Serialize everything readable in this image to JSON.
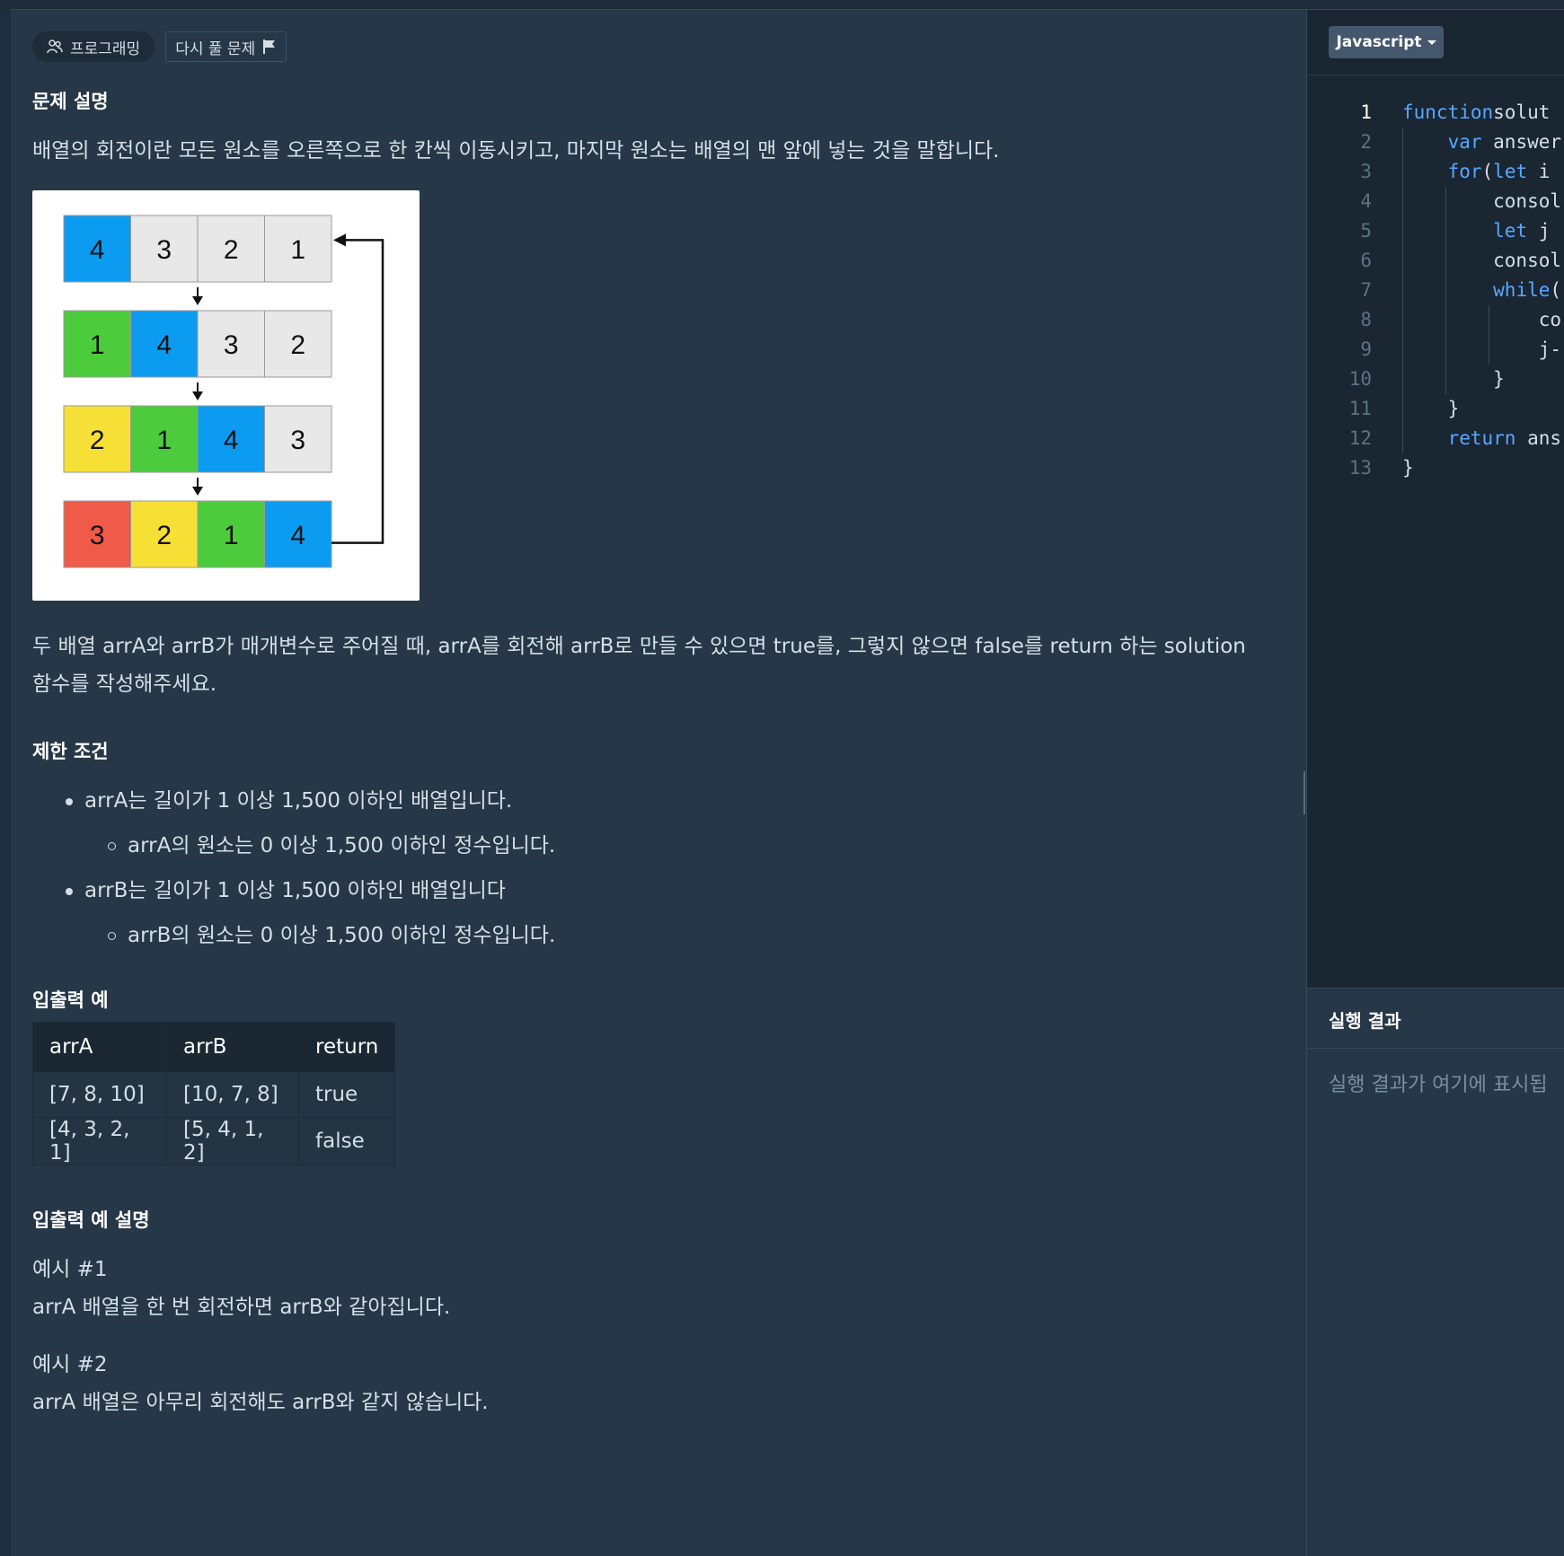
{
  "header": {
    "category_badge": "프로그래밍",
    "retry_badge": "다시 풀 문제"
  },
  "problem": {
    "section_title": "문제 설명",
    "intro": "배열의 회전이란 모든 원소를 오른쪽으로 한 칸씩 이동시키고, 마지막 원소는 배열의 맨 앞에 넣는 것을 말합니다.",
    "figure": {
      "rows": [
        [
          {
            "v": "4",
            "c": "#0b9cf2"
          },
          {
            "v": "3",
            "c": "#e8e8e8"
          },
          {
            "v": "2",
            "c": "#e8e8e8"
          },
          {
            "v": "1",
            "c": "#e8e8e8"
          }
        ],
        [
          {
            "v": "1",
            "c": "#4ccc3d"
          },
          {
            "v": "4",
            "c": "#0b9cf2"
          },
          {
            "v": "3",
            "c": "#e8e8e8"
          },
          {
            "v": "2",
            "c": "#e8e8e8"
          }
        ],
        [
          {
            "v": "2",
            "c": "#f7e035"
          },
          {
            "v": "1",
            "c": "#4ccc3d"
          },
          {
            "v": "4",
            "c": "#0b9cf2"
          },
          {
            "v": "3",
            "c": "#e8e8e8"
          }
        ],
        [
          {
            "v": "3",
            "c": "#f05a48"
          },
          {
            "v": "2",
            "c": "#f7e035"
          },
          {
            "v": "1",
            "c": "#4ccc3d"
          },
          {
            "v": "4",
            "c": "#0b9cf2"
          }
        ]
      ]
    },
    "task_line1": "두 배열 arrA와 arrB가 매개변수로 주어질 때, arrA를 회전해 arrB로 만들 수 있으면 true를, 그렇지 않으면 false를 return 하는 solution",
    "task_line2": "함수를 작성해주세요."
  },
  "constraints": {
    "title": "제한 조건",
    "items": [
      "arrA는 길이가 1 이상 1,500 이하인 배열입니다.",
      "arrA의 원소는 0 이상 1,500 이하인 정수입니다.",
      "arrB는 길이가 1 이상 1,500 이하인 배열입니다",
      "arrB의 원소는 0 이상 1,500 이하인 정수입니다."
    ]
  },
  "examples": {
    "title": "입출력 예",
    "headers": [
      "arrA",
      "arrB",
      "return"
    ],
    "rows": [
      [
        "[7, 8, 10]",
        "[10, 7, 8]",
        "true"
      ],
      [
        "[4, 3, 2, 1]",
        "[5, 4, 1, 2]",
        "false"
      ]
    ]
  },
  "explanation": {
    "title": "입출력 예 설명",
    "ex1_label": "예시 #1",
    "ex1_text": "arrA 배열을 한 번 회전하면 arrB와 같아집니다.",
    "ex2_label": "예시 #2",
    "ex2_text": "arrA 배열은 아무리 회전해도 arrB와 같지 않습니다."
  },
  "editor": {
    "language": "Javascript",
    "lines": [
      {
        "n": "1",
        "t": [
          [
            "kw",
            "function"
          ],
          [
            "",
            "solut"
          ]
        ]
      },
      {
        "n": "2",
        "t": [
          [
            "",
            "    "
          ],
          [
            "kw",
            "var"
          ],
          [
            "",
            " answer"
          ]
        ]
      },
      {
        "n": "3",
        "t": [
          [
            "",
            "    "
          ],
          [
            "kw",
            "for"
          ],
          [
            "",
            "("
          ],
          [
            "kw",
            "let"
          ],
          [
            "",
            " i"
          ]
        ]
      },
      {
        "n": "4",
        "t": [
          [
            "",
            "        consol"
          ]
        ]
      },
      {
        "n": "5",
        "t": [
          [
            "",
            "        "
          ],
          [
            "kw",
            "let"
          ],
          [
            "",
            " j"
          ]
        ]
      },
      {
        "n": "6",
        "t": [
          [
            "",
            "        consol"
          ]
        ]
      },
      {
        "n": "7",
        "t": [
          [
            "",
            "        "
          ],
          [
            "kw",
            "while"
          ],
          [
            "",
            "("
          ]
        ]
      },
      {
        "n": "8",
        "t": [
          [
            "",
            "            co"
          ]
        ]
      },
      {
        "n": "9",
        "t": [
          [
            "",
            "            j-"
          ]
        ]
      },
      {
        "n": "10",
        "t": [
          [
            "",
            "        }"
          ]
        ]
      },
      {
        "n": "11",
        "t": [
          [
            "",
            "    }"
          ]
        ]
      },
      {
        "n": "12",
        "t": [
          [
            "",
            "    "
          ],
          [
            "kw",
            "return"
          ],
          [
            "",
            " ans"
          ]
        ]
      },
      {
        "n": "13",
        "t": [
          [
            "",
            "}"
          ]
        ]
      }
    ]
  },
  "result": {
    "title": "실행 결과",
    "placeholder": "실행 결과가 여기에 표시됩"
  }
}
